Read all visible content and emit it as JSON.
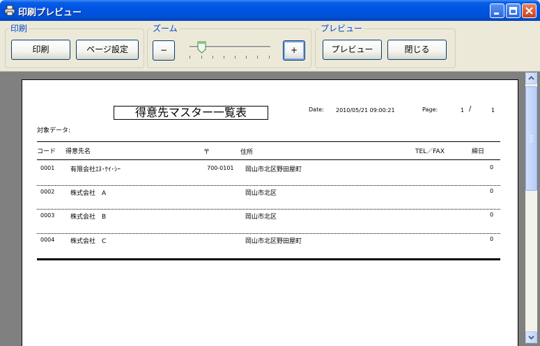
{
  "window": {
    "title": "印刷プレビュー",
    "controls": [
      "minimize-icon",
      "maximize-icon",
      "close-icon"
    ]
  },
  "toolbar": {
    "print_group": {
      "title": "印刷",
      "print_label": "印刷",
      "page_setup_label": "ページ設定"
    },
    "zoom_group": {
      "title": "ズーム",
      "zoom_out_label": "−",
      "zoom_in_label": "+"
    },
    "preview_group": {
      "title": "プレビュー",
      "preview_label": "プレビュー",
      "close_label": "閉じる"
    }
  },
  "report": {
    "title": "得意先マスター一覧表",
    "date_label": "Date:",
    "date_value": "2010/05/21  09:00:21",
    "page_label": "Page:",
    "page_current": "1",
    "page_sep": "/",
    "page_total": "1",
    "target_label": "対象データ:",
    "columns": {
      "code": "コード",
      "name": "得意先名",
      "zip": "〒",
      "address": "住所",
      "tel": "TEL／FAX",
      "closing": "締日"
    },
    "rows": [
      {
        "code": "0001",
        "name": "有限会社ｴﾇ･ｹｲ･ｼｰ",
        "zip": "700-0101",
        "address": "岡山市北区野田屋町",
        "closing": "0"
      },
      {
        "code": "0002",
        "name": "株式会社　A",
        "zip": "",
        "address": "岡山市北区",
        "closing": "0"
      },
      {
        "code": "0003",
        "name": "株式会社　B",
        "zip": "",
        "address": "岡山市北区",
        "closing": "0"
      },
      {
        "code": "0004",
        "name": "株式会社　C",
        "zip": "",
        "address": "岡山市北区野田屋町",
        "closing": "0"
      }
    ]
  },
  "colors": {
    "titlebar": "#0054e3",
    "group_title": "#0046d5",
    "workspace": "#808080"
  }
}
